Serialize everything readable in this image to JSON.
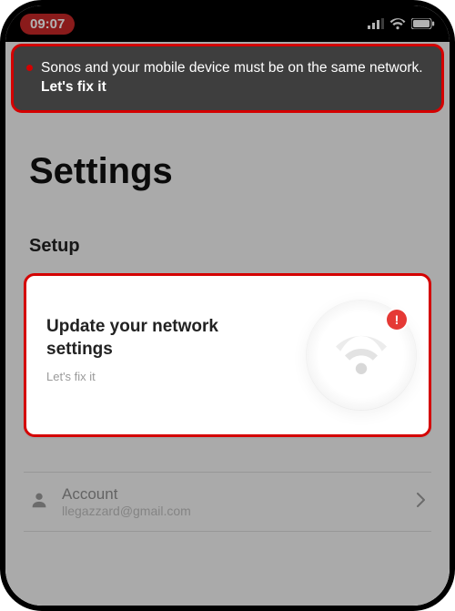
{
  "status": {
    "time": "09:07"
  },
  "banner": {
    "text": "Sonos and your mobile device must be on the same network. ",
    "fix": "Let's fix it"
  },
  "page": {
    "title": "Settings",
    "section": "Setup"
  },
  "card": {
    "title": "Update your network settings",
    "sub": "Let's fix it",
    "badge": "!"
  },
  "account": {
    "label": "Account",
    "email": "llegazzard@gmail.com"
  }
}
